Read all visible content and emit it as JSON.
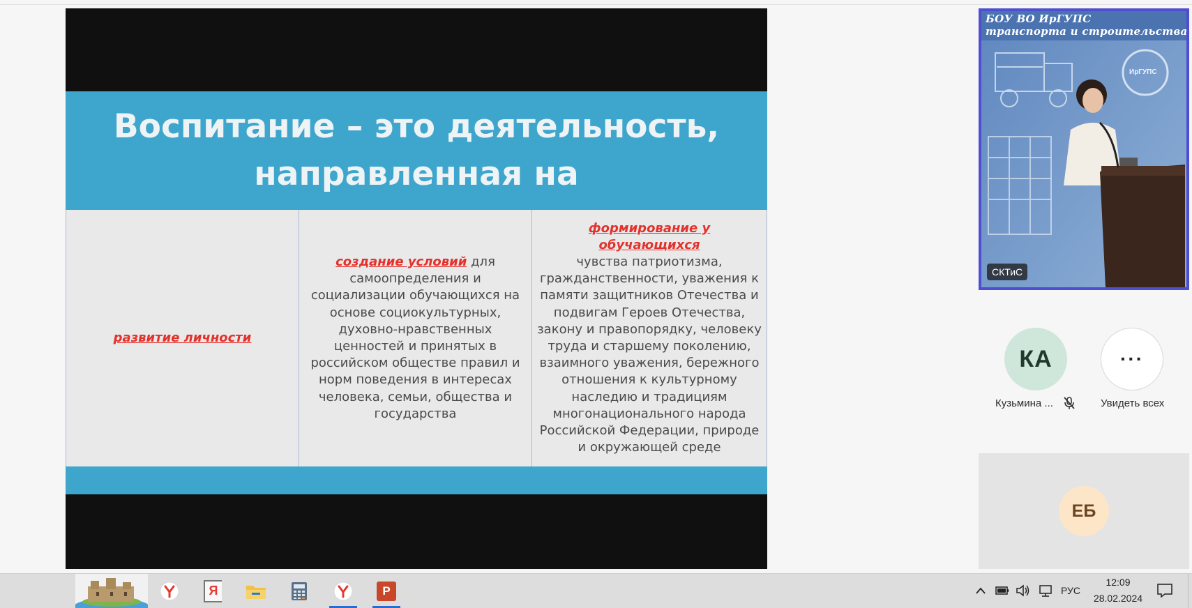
{
  "slide": {
    "title": "Воспитание – это деятельность,\nнаправленная на",
    "col1": {
      "highlight": "развитие личности"
    },
    "col2": {
      "highlight": "создание условий",
      "text": " для самоопределения и социализации обучающихся на основе социокультурных, духовно-нравственных ценностей и принятых в российском обществе правил и норм поведения в интересах человека, семьи, общества и государства"
    },
    "col3": {
      "highlight": "формирование у обучающихся",
      "text": "чувства патриотизма, гражданственности, уважения к памяти защитников Отечества и подвигам Героев Отечества, закону и правопорядку, человеку труда и старшему поколению, взаимного уважения, бережного отношения к культурному наследию и традициям многонационального народа Российской Федерации, природе и окружающей среде"
    },
    "colors": {
      "band": "#3ea6cc",
      "highlight": "#e3322c"
    }
  },
  "video": {
    "banner_line1": "БОУ ВО ИрГУПС",
    "banner_line2": "транспорта и строительства",
    "logo_text": "ИрГУПС",
    "name": "СКТиС"
  },
  "participants": {
    "ka": {
      "initials": "КА",
      "label": "Кузьмина ..."
    },
    "more": {
      "glyph": "···",
      "label": "Увидеть всех"
    },
    "eb": {
      "initials": "ЕБ"
    }
  },
  "taskbar": {
    "language": "РУС",
    "time": "12:09",
    "date": "28.02.2024",
    "yandex_browser_letter": "Я",
    "powerpoint_letter": "P"
  }
}
